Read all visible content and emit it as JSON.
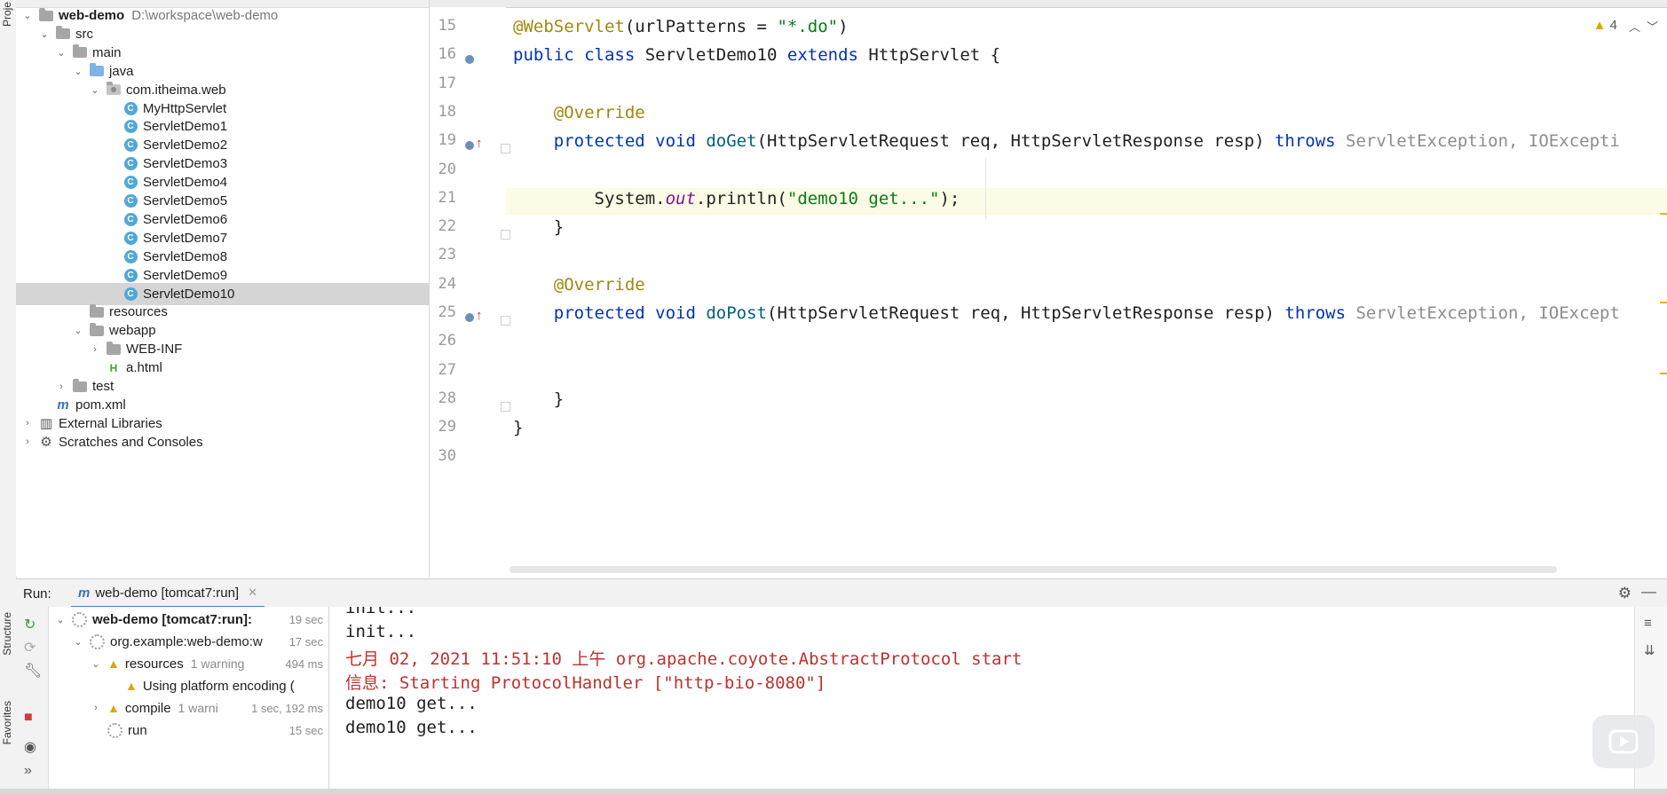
{
  "left_stripe": {
    "project_label": "Proje",
    "structure_label": "Structure",
    "favorites_label": "Favorites"
  },
  "project_tree": [
    {
      "label": "web-demo",
      "path": "D:\\workspace\\web-demo",
      "icon": "module-folder-icon",
      "depth": 0,
      "expanded": true,
      "bold": true
    },
    {
      "label": "src",
      "icon": "folder-icon",
      "depth": 1,
      "expanded": true
    },
    {
      "label": "main",
      "icon": "folder-icon",
      "depth": 2,
      "expanded": true
    },
    {
      "label": "java",
      "icon": "source-folder-icon",
      "depth": 3,
      "expanded": true
    },
    {
      "label": "com.itheima.web",
      "icon": "package-icon",
      "depth": 4,
      "expanded": true
    },
    {
      "label": "MyHttpServlet",
      "icon": "class-icon",
      "depth": 5
    },
    {
      "label": "ServletDemo1",
      "icon": "class-icon",
      "depth": 5
    },
    {
      "label": "ServletDemo2",
      "icon": "class-icon",
      "depth": 5
    },
    {
      "label": "ServletDemo3",
      "icon": "class-icon",
      "depth": 5
    },
    {
      "label": "ServletDemo4",
      "icon": "class-icon",
      "depth": 5
    },
    {
      "label": "ServletDemo5",
      "icon": "class-icon",
      "depth": 5
    },
    {
      "label": "ServletDemo6",
      "icon": "class-icon",
      "depth": 5
    },
    {
      "label": "ServletDemo7",
      "icon": "class-icon",
      "depth": 5
    },
    {
      "label": "ServletDemo8",
      "icon": "class-icon",
      "depth": 5
    },
    {
      "label": "ServletDemo9",
      "icon": "class-icon",
      "depth": 5
    },
    {
      "label": "ServletDemo10",
      "icon": "class-icon",
      "depth": 5,
      "selected": true
    },
    {
      "label": "resources",
      "icon": "folder-icon",
      "depth": 3
    },
    {
      "label": "webapp",
      "icon": "web-folder-icon",
      "depth": 3,
      "expanded": true
    },
    {
      "label": "WEB-INF",
      "icon": "folder-icon",
      "depth": 4,
      "collapsed": true
    },
    {
      "label": "a.html",
      "icon": "html-file-icon",
      "depth": 4
    },
    {
      "label": "test",
      "icon": "folder-icon",
      "depth": 2,
      "collapsed": true
    },
    {
      "label": "pom.xml",
      "icon": "maven-file-icon",
      "depth": 1
    },
    {
      "label": "External Libraries",
      "icon": "libraries-icon",
      "depth": 0,
      "collapsed": true
    },
    {
      "label": "Scratches and Consoles",
      "icon": "scratches-icon",
      "depth": 0,
      "collapsed": true
    }
  ],
  "editor": {
    "warning_count": "4",
    "lines": [
      {
        "n": "15",
        "parts": [
          [
            "ann",
            "@WebServlet"
          ],
          [
            "",
            "(urlPatterns = "
          ],
          [
            "str",
            "\"*.do\""
          ],
          [
            "",
            ")"
          ]
        ]
      },
      {
        "n": "16",
        "parts": [
          [
            "kw",
            "public class "
          ],
          [
            "",
            "ServletDemo10 "
          ],
          [
            "kw",
            "extends "
          ],
          [
            "",
            "HttpServlet {"
          ]
        ]
      },
      {
        "n": "17",
        "parts": []
      },
      {
        "n": "18",
        "parts": [
          [
            "",
            "    "
          ],
          [
            "ann",
            "@Override"
          ]
        ]
      },
      {
        "n": "19",
        "parts": [
          [
            "",
            "    "
          ],
          [
            "kw",
            "protected void "
          ],
          [
            "fn",
            "doGet"
          ],
          [
            "",
            "(HttpServletRequest req, HttpServletResponse resp) "
          ],
          [
            "kw",
            "throws "
          ],
          [
            "gray",
            "ServletException, IOExcepti"
          ]
        ]
      },
      {
        "n": "20",
        "parts": []
      },
      {
        "n": "21",
        "parts": [
          [
            "",
            "        System."
          ],
          [
            "fld",
            "out"
          ],
          [
            "",
            ".println("
          ],
          [
            "str",
            "\"demo10 get...\""
          ],
          [
            "",
            ");"
          ]
        ]
      },
      {
        "n": "22",
        "parts": [
          [
            "",
            "    }"
          ]
        ]
      },
      {
        "n": "23",
        "parts": []
      },
      {
        "n": "24",
        "parts": [
          [
            "",
            "    "
          ],
          [
            "ann",
            "@Override"
          ]
        ]
      },
      {
        "n": "25",
        "parts": [
          [
            "",
            "    "
          ],
          [
            "kw",
            "protected void "
          ],
          [
            "fn",
            "doPost"
          ],
          [
            "",
            "(HttpServletRequest req, HttpServletResponse resp) "
          ],
          [
            "kw",
            "throws "
          ],
          [
            "gray",
            "ServletException, IOExcept"
          ]
        ]
      },
      {
        "n": "26",
        "parts": []
      },
      {
        "n": "27",
        "parts": []
      },
      {
        "n": "28",
        "parts": [
          [
            "",
            "    }"
          ]
        ]
      },
      {
        "n": "29",
        "parts": [
          [
            "",
            "}"
          ]
        ]
      },
      {
        "n": "30",
        "parts": []
      }
    ]
  },
  "run_panel": {
    "title": "Run:",
    "tab_label": "web-demo [tomcat7:run]",
    "tree": [
      {
        "label": "web-demo [tomcat7:run]:",
        "time": "19 sec",
        "icon": "spinner-icon",
        "depth": 0,
        "expanded": true,
        "bold": true
      },
      {
        "label": "org.example:web-demo:w",
        "time": "17 sec",
        "icon": "spinner-icon",
        "depth": 1,
        "expanded": true
      },
      {
        "label": "resources",
        "sub": "1 warning",
        "time": "494 ms",
        "icon": "warning-icon",
        "depth": 2,
        "expanded": true
      },
      {
        "label": "Using platform encoding (",
        "icon": "warning-icon",
        "depth": 3
      },
      {
        "label": "compile",
        "sub": "1 warni",
        "time": "1 sec, 192 ms",
        "icon": "warning-icon",
        "depth": 2,
        "collapsed": true
      },
      {
        "label": "run",
        "time": "15 sec",
        "icon": "spinner-icon",
        "depth": 2
      }
    ],
    "console": [
      {
        "text": "init...",
        "red": false
      },
      {
        "text": "init...",
        "red": false
      },
      {
        "text": "七月 02, 2021 11:51:10 上午 org.apache.coyote.AbstractProtocol start",
        "red": true
      },
      {
        "text": "信息: Starting ProtocolHandler [\"http-bio-8080\"]",
        "red": true
      },
      {
        "text": "demo10 get...",
        "red": false
      },
      {
        "text": "demo10 get...",
        "red": false
      }
    ]
  },
  "colors": {
    "accent": "#4a86c8",
    "class_icon": "#4fa8d8",
    "warning": "#e0a400",
    "selection": "#d5d5d5"
  }
}
